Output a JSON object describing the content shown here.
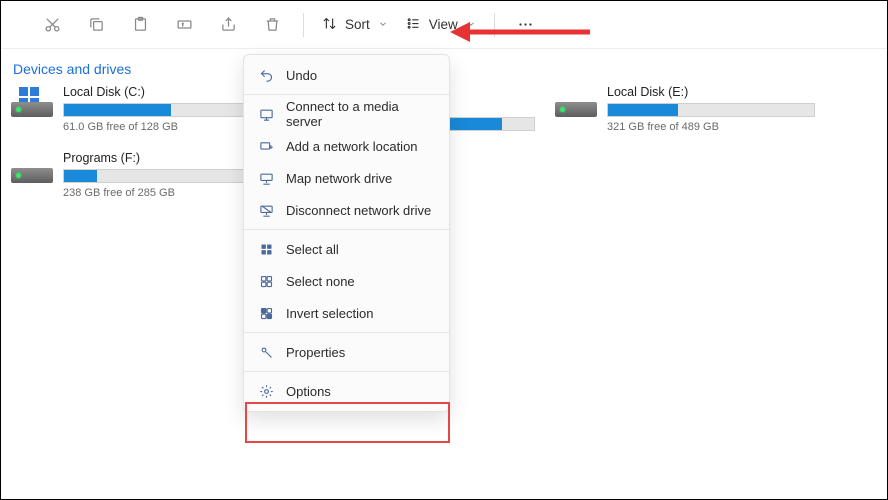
{
  "toolbar": {
    "sort_label": "Sort",
    "view_label": "View"
  },
  "section_title": "Devices and drives",
  "drives": [
    {
      "name": "Local Disk (C:)",
      "status": "61.0 GB free of 128 GB",
      "fill_pct": 52,
      "has_winlogo": true
    },
    {
      "name": "Local Disk (E:)",
      "status": "321 GB free of 489 GB",
      "fill_pct": 34,
      "has_winlogo": false
    },
    {
      "name": "Programs (F:)",
      "status": "238 GB free of 285 GB",
      "fill_pct": 16,
      "has_winlogo": false
    }
  ],
  "menu": {
    "undo": "Undo",
    "connect_media": "Connect to a media server",
    "add_network": "Add a network location",
    "map_drive": "Map network drive",
    "disconnect_drive": "Disconnect network drive",
    "select_all": "Select all",
    "select_none": "Select none",
    "invert_selection": "Invert selection",
    "properties": "Properties",
    "options": "Options"
  }
}
